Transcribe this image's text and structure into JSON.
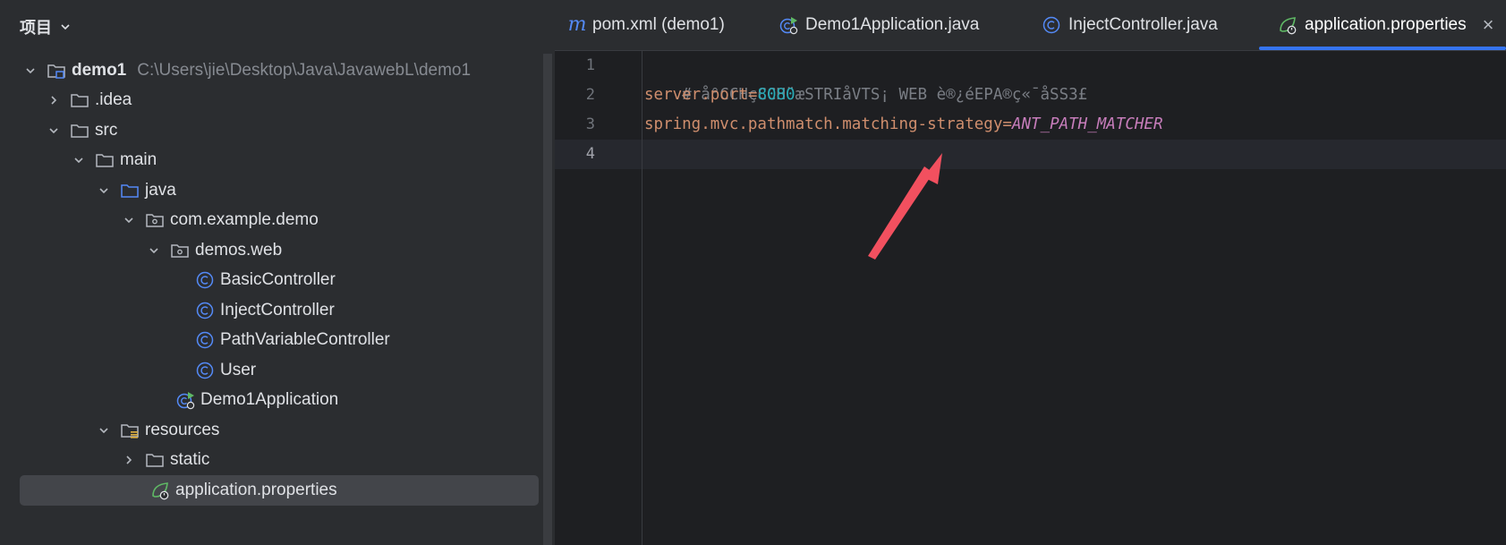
{
  "panel": {
    "title": "项目"
  },
  "tree": [
    {
      "label": "demo1",
      "hint": "C:\\Users\\jie\\Desktop\\Java\\JavawebL\\demo1",
      "icon": "module-folder-icon",
      "expanded": true
    },
    {
      "label": ".idea",
      "icon": "folder-icon",
      "expanded": false
    },
    {
      "label": "src",
      "icon": "folder-icon",
      "expanded": true
    },
    {
      "label": "main",
      "icon": "folder-icon",
      "expanded": true
    },
    {
      "label": "java",
      "icon": "source-folder-icon",
      "expanded": true
    },
    {
      "label": "com.example.demo",
      "icon": "package-icon",
      "expanded": true
    },
    {
      "label": "demos.web",
      "icon": "package-icon",
      "expanded": true
    },
    {
      "label": "BasicController",
      "icon": "class-icon"
    },
    {
      "label": "InjectController",
      "icon": "class-icon"
    },
    {
      "label": "PathVariableController",
      "icon": "class-icon"
    },
    {
      "label": "User",
      "icon": "class-icon"
    },
    {
      "label": "Demo1Application",
      "icon": "spring-app-icon"
    },
    {
      "label": "resources",
      "icon": "resources-folder-icon",
      "expanded": true
    },
    {
      "label": "static",
      "icon": "folder-icon",
      "expanded": false
    },
    {
      "label": "application.properties",
      "icon": "spring-properties-icon",
      "selected": true
    }
  ],
  "tabs": [
    {
      "label": "pom.xml (demo1)",
      "icon": "maven-icon"
    },
    {
      "label": "Demo1Application.java",
      "icon": "spring-app-icon"
    },
    {
      "label": "InjectController.java",
      "icon": "class-icon"
    },
    {
      "label": "application.properties",
      "icon": "spring-properties-icon",
      "active": true
    }
  ],
  "tab_close": "×",
  "editor": {
    "line_numbers": [
      "1",
      "2",
      "3",
      "4"
    ],
    "current_line": 4,
    "lines": [
      {
        "comment": "# å°CCHçCCH¨æSTRIåVTS¡ WEB è®¿éEPA®ç«¯åSS3£"
      },
      {
        "key": "server.port",
        "eq": "=",
        "value": "8080"
      },
      {
        "key": "spring.mvc.pathmatch.matching-strategy",
        "eq": "=",
        "value": "ANT_PATH_MATCHER"
      },
      {}
    ]
  },
  "colors": {
    "accent": "#3574f0",
    "annotation_arrow": "#f2505f",
    "key": "#cf8e6d",
    "number": "#2aacb8",
    "constant": "#c77dbb"
  }
}
